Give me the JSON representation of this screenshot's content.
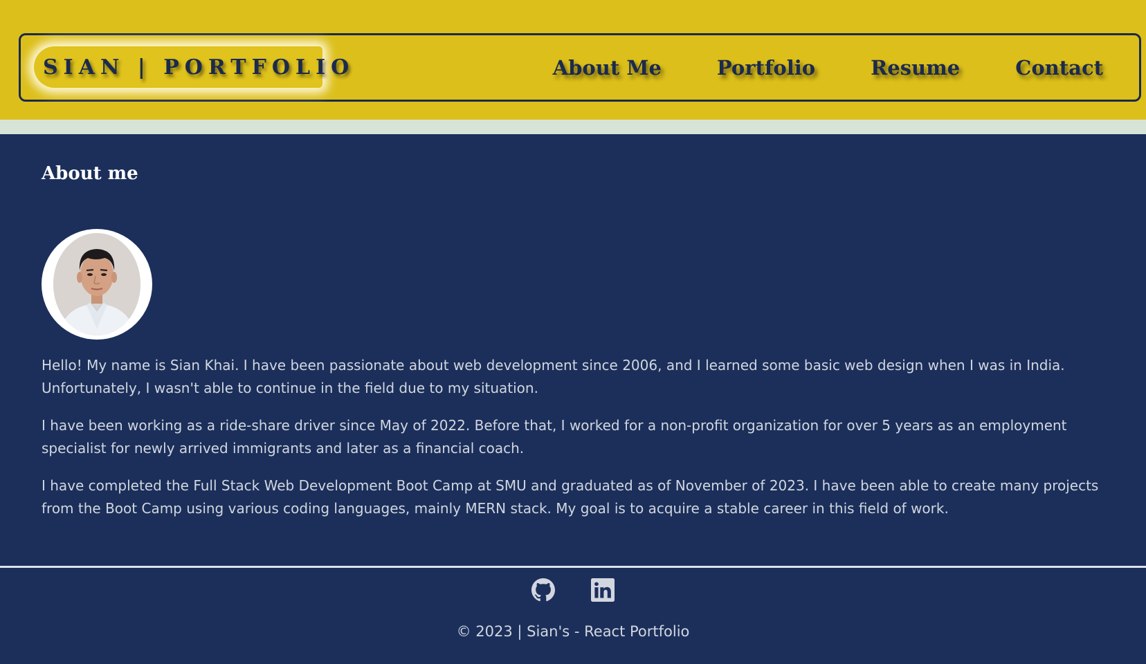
{
  "header": {
    "brand": "SIAN | PORTFOLIO",
    "nav": [
      {
        "label": "About Me"
      },
      {
        "label": "Portfolio"
      },
      {
        "label": "Resume"
      },
      {
        "label": "Contact"
      }
    ]
  },
  "main": {
    "title": "About me",
    "avatar_icon": "profile-photo",
    "paragraphs": [
      "Hello! My name is Sian Khai. I have been passionate about web development since 2006, and I learned some basic web design when I was in India. Unfortunately, I wasn't able to continue in the field due to my situation.",
      "I have been working as a ride-share driver since May of 2022. Before that, I worked for a non-profit organization for over 5 years as an employment specialist for newly arrived immigrants and later as a financial coach.",
      "I have completed the Full Stack Web Development Boot Camp at SMU and graduated as of November of 2023. I have been able to create many projects from the Boot Camp using various coding languages, mainly MERN stack. My goal is to acquire a stable career in this field of work."
    ]
  },
  "footer": {
    "icons": [
      "github-icon",
      "linkedin-icon"
    ],
    "copyright": "© 2023 | Sian's - React Portfolio"
  },
  "colors": {
    "header_bg": "#dcbf1a",
    "stripe": "#d6e4d8",
    "page_bg": "#1b2f5a",
    "brand_navy": "#1b2a4d",
    "body_text": "#d2d6e0"
  }
}
